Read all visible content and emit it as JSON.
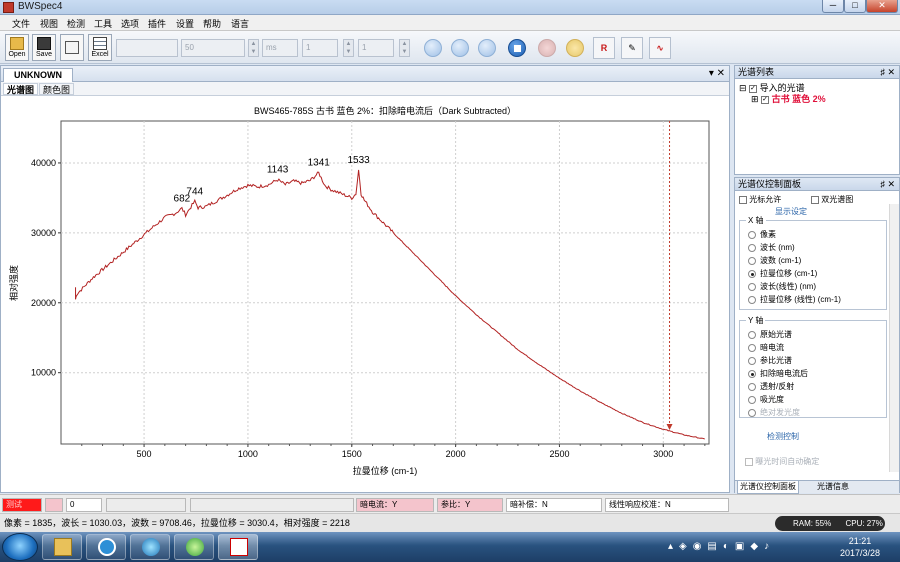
{
  "window": {
    "title": "BWSpec4",
    "minimize": "─",
    "maximize": "□",
    "close": "✕"
  },
  "menu": [
    "文件",
    "视图",
    "检测",
    "工具",
    "选项",
    "插件",
    "设置",
    "帮助",
    "语言"
  ],
  "toolbar": {
    "open_label": "Open",
    "save_label": "Save",
    "excel_label": "Excel",
    "field2_value": "50",
    "unit_value": "ms",
    "field3_value": "1",
    "field4_value": "1",
    "r_label": "R"
  },
  "document": {
    "tab_label": "UNKNOWN",
    "tab_controls": "▾ ✕",
    "subtabs": [
      "光谱图",
      "颜色图"
    ]
  },
  "chart_data": {
    "type": "line",
    "title": "BWS465-785S  古书 蓝色 2%：扣除暗电流后（Dark Subtracted）",
    "xlabel": "拉曼位移 (cm-1)",
    "ylabel": "相对强度",
    "xlim": [
      100,
      3220
    ],
    "ylim": [
      -200,
      46000
    ],
    "xticks": [
      500,
      1000,
      1500,
      2000,
      2500,
      3000
    ],
    "yticks": [
      10000,
      20000,
      30000,
      40000
    ],
    "grid": true,
    "color": "#b22222",
    "cursor_x": 3030,
    "x": [
      170,
      175,
      250,
      350,
      450,
      550,
      600,
      650,
      682,
      700,
      744,
      760,
      800,
      850,
      900,
      950,
      1000,
      1050,
      1100,
      1143,
      1180,
      1220,
      1260,
      1300,
      1341,
      1370,
      1400,
      1450,
      1500,
      1520,
      1533,
      1545,
      1560,
      1600,
      1700,
      1800,
      1900,
      2000,
      2100,
      2200,
      2300,
      2400,
      2500,
      2600,
      2700,
      2800,
      2900,
      3000,
      3100,
      3200
    ],
    "y": [
      20500,
      21200,
      23500,
      26000,
      28500,
      31000,
      32200,
      32800,
      33500,
      32600,
      34500,
      33600,
      33800,
      34600,
      35400,
      36300,
      36800,
      36600,
      36900,
      37600,
      36900,
      37400,
      37100,
      37500,
      38600,
      36800,
      36200,
      35600,
      35000,
      35600,
      39000,
      35600,
      34700,
      33000,
      30000,
      27000,
      24000,
      21000,
      18300,
      15800,
      13300,
      11200,
      9200,
      7400,
      5700,
      4200,
      2900,
      1900,
      1100,
      500
    ],
    "peak_labels": [
      {
        "x": 682,
        "y": 33500,
        "text": "682"
      },
      {
        "x": 744,
        "y": 34500,
        "text": "744"
      },
      {
        "x": 1143,
        "y": 37600,
        "text": "1143"
      },
      {
        "x": 1341,
        "y": 38600,
        "text": "1341"
      },
      {
        "x": 1533,
        "y": 39000,
        "text": "1533"
      }
    ]
  },
  "spectrum_list": {
    "title": "光谱列表",
    "pin": "♯ ✕",
    "root_label": "导入的光谱",
    "child_label": "古书 蓝色 2%",
    "child_color": "#e0103a"
  },
  "control_panel": {
    "title": "光谱仪控制面板",
    "pin": "♯ ✕",
    "cursor_allowed": "光标允许",
    "dual_chart": "双光谱图",
    "display_settings": "显示设定",
    "x_axis_label": "X 轴",
    "x_options": [
      "像素",
      "波长 (nm)",
      "波数 (cm-1)",
      "拉曼位移 (cm-1)",
      "波长(线性) (nm)",
      "拉曼位移 (线性) (cm-1)"
    ],
    "x_selected": 3,
    "y_axis_label": "Y 轴",
    "y_options": [
      "原始光谱",
      "暗电流",
      "参比光谱",
      "扣除暗电流后",
      "透射/反射",
      "吸光度",
      "绝对发光度"
    ],
    "y_selected": 3,
    "detect_control": "检测控制",
    "auto_integration": "曝光时间自动确定",
    "bottom_tabs": [
      "光谱仪控制面板",
      "光谱信息"
    ]
  },
  "statusbar": {
    "red_label": "测试",
    "count_value": "0",
    "dark_current": "暗电流：Y",
    "reference": "参比：Y",
    "dark_compensation": "暗补偿：N",
    "linearity": "线性响应校准：N",
    "status_text": "像素 = 1835，波长 = 1030.03，波数 = 9708.46，拉曼位移 = 3030.4，相对强度 = 2218"
  },
  "system": {
    "ram": "RAM: 55%",
    "cpu": "CPU: 27%",
    "time": "21:21",
    "date": "2017/3/28"
  }
}
